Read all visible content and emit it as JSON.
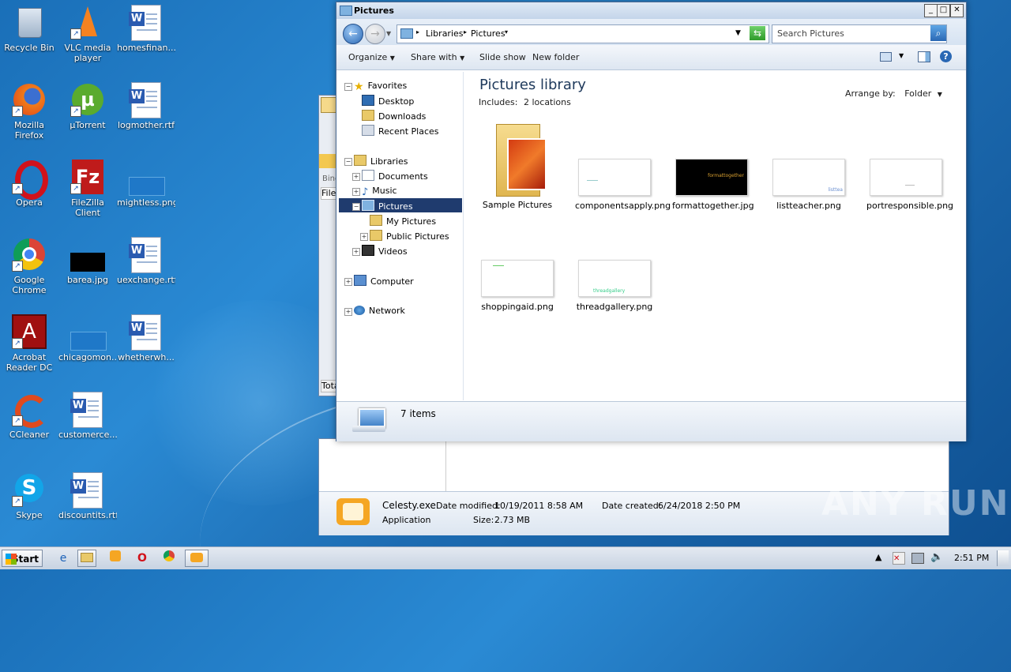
{
  "desktop": {
    "icons": [
      {
        "label": "Recycle Bin"
      },
      {
        "label": "VLC media player"
      },
      {
        "label": "homesfinan..."
      },
      {
        "label": "Mozilla Firefox"
      },
      {
        "label": "µTorrent"
      },
      {
        "label": "logmother.rtf"
      },
      {
        "label": "Opera"
      },
      {
        "label": "FileZilla Client"
      },
      {
        "label": "mightless.png"
      },
      {
        "label": "Google Chrome"
      },
      {
        "label": "barea.jpg"
      },
      {
        "label": "uexchange.rtf"
      },
      {
        "label": "Acrobat Reader DC"
      },
      {
        "label": "chicagomon..."
      },
      {
        "label": "whetherwh..."
      },
      {
        "label": "CCleaner"
      },
      {
        "label": "customerce..."
      },
      {
        "label": "Skype"
      },
      {
        "label": "discountits.rtf"
      }
    ]
  },
  "bg_window": {
    "bind_label": "Bind",
    "file_label": "File",
    "total_label": "Tota",
    "details": {
      "name": "Celesty.exe",
      "modified_label": "Date modified:",
      "modified": "10/19/2011 8:58 AM",
      "created_label": "Date created:",
      "created": "6/24/2018 2:50 PM",
      "type": "Application",
      "size_label": "Size:",
      "size": "2.73 MB"
    }
  },
  "explorer": {
    "title": "Pictures",
    "breadcrumb": [
      "Libraries",
      "Pictures"
    ],
    "search_placeholder": "Search Pictures",
    "toolbar": {
      "organize": "Organize",
      "share_with": "Share with",
      "slide_show": "Slide show",
      "new_folder": "New folder"
    },
    "nav": {
      "favorites": "Favorites",
      "desktop": "Desktop",
      "downloads": "Downloads",
      "recent_places": "Recent Places",
      "libraries": "Libraries",
      "documents": "Documents",
      "music": "Music",
      "pictures": "Pictures",
      "my_pictures": "My Pictures",
      "public_pictures": "Public Pictures",
      "videos": "Videos",
      "computer": "Computer",
      "network": "Network"
    },
    "library_title": "Pictures library",
    "includes_label": "Includes:",
    "includes_value": "2 locations",
    "arrange_label": "Arrange by:",
    "arrange_value": "Folder",
    "files": [
      {
        "name": "Sample Pictures"
      },
      {
        "name": "componentsapply.png"
      },
      {
        "name": "formattogether.jpg",
        "thumb_text": "formattogether"
      },
      {
        "name": "listteacher.png",
        "thumb_text": "listtea"
      },
      {
        "name": "portresponsible.png"
      },
      {
        "name": "shoppingaid.png"
      },
      {
        "name": "threadgallery.png",
        "thumb_text": "threadgallery"
      }
    ],
    "status": "7 items"
  },
  "taskbar": {
    "start": "Start",
    "clock": "2:51 PM"
  },
  "watermark": "ANY RUN"
}
